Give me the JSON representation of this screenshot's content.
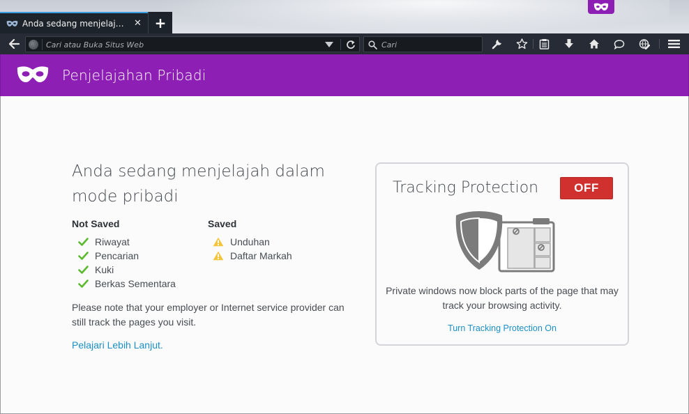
{
  "window": {
    "tab_title": "Anda sedang menjelajah d...",
    "new_tab_symbol": "+",
    "close_symbol": "✕"
  },
  "navbar": {
    "url_placeholder": "Cari atau Buka Situs Web",
    "search_placeholder": "Cari"
  },
  "header": {
    "title": "Penjelajahan Pribadi"
  },
  "main": {
    "heading": "Anda sedang menjelajah dalam mode pribadi",
    "not_saved": {
      "title": "Not Saved",
      "items": [
        "Riwayat",
        "Pencarian",
        "Kuki",
        "Berkas Sementara"
      ]
    },
    "saved": {
      "title": "Saved",
      "items": [
        "Unduhan",
        "Daftar Markah"
      ]
    },
    "note": "Please note that your employer or Internet service provider can still track the pages you visit.",
    "learn_more": "Pelajari Lebih Lanjut."
  },
  "tracking": {
    "title": "Tracking Protection",
    "toggle_label": "OFF",
    "description": "Private windows now block parts of the page that may track your browsing activity.",
    "link": "Turn Tracking Protection On"
  },
  "colors": {
    "private_purple": "#8d1fb4",
    "toggle_red": "#d1312e",
    "check_green": "#5ab92e",
    "warning_yellow": "#f5c43d",
    "link_blue": "#1a8fc7"
  }
}
